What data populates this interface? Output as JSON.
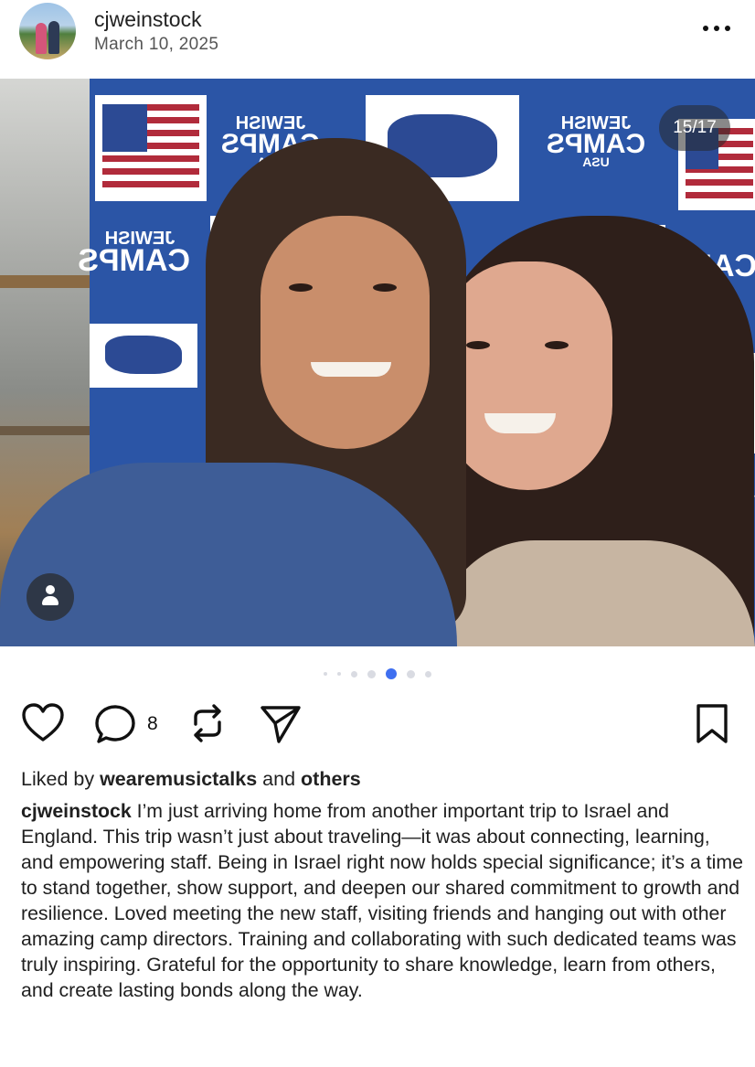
{
  "post": {
    "username": "cjweinstock",
    "date": "March 10, 2025",
    "counter": "15/17",
    "photo_logo_text": [
      "JEWISH",
      "CAMPS",
      "USA"
    ]
  },
  "carousel": {
    "dots": 7,
    "active_index": 4
  },
  "actions": {
    "comment_count": "8"
  },
  "likes": {
    "prefix": "Liked by",
    "user": "wearemusictalks",
    "conj": "and",
    "others": "others"
  },
  "caption": {
    "user": "cjweinstock",
    "text": "I’m just arriving home from another important trip to Israel and England. This trip wasn’t just about traveling—it was about connecting, learning, and empowering staff. Being in Israel right now holds special significance; it’s a time to stand together, show support, and deepen our shared commitment to growth and resilience. Loved meeting the new staff, visiting friends and hanging out with other amazing camp directors. Training and collaborating with such dedicated teams was truly inspiring. Grateful for the opportunity to share knowledge, learn from others, and create lasting bonds along the way."
  },
  "colors": {
    "accent_dot": "#3f6ff0",
    "backdrop": "#2b55a6"
  },
  "icons": [
    "more-options-icon",
    "user-tag-icon",
    "heart-icon",
    "comment-icon",
    "repost-icon",
    "share-icon",
    "bookmark-icon"
  ]
}
